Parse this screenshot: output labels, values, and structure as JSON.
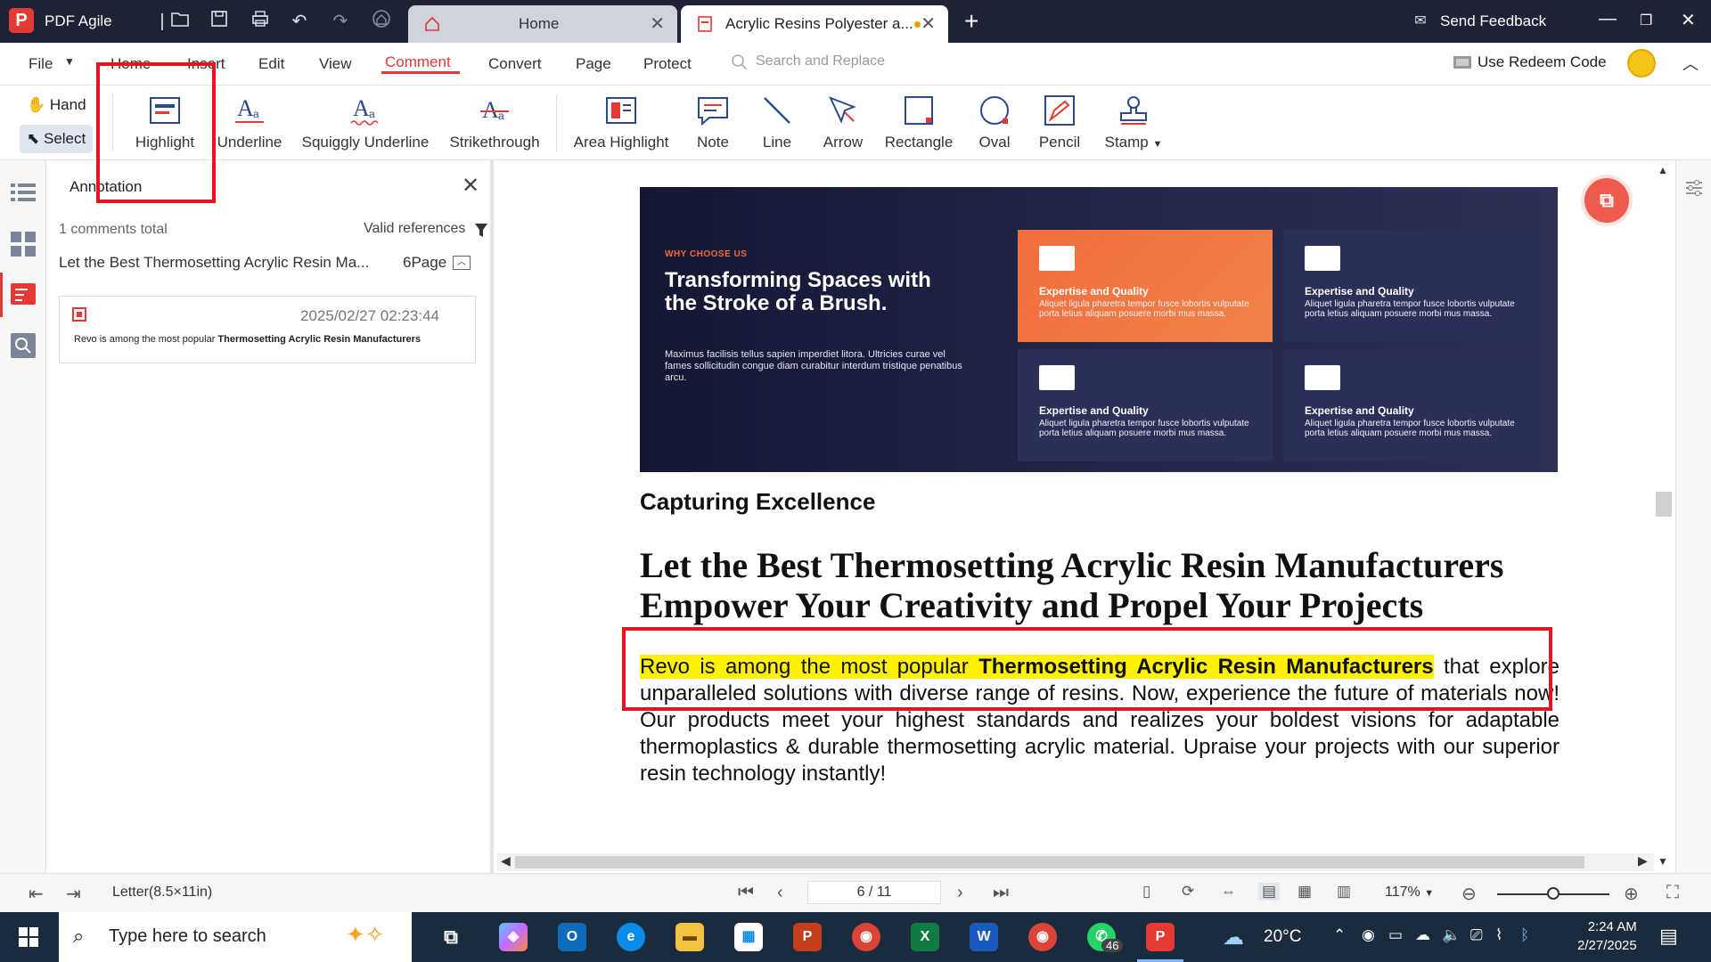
{
  "app": {
    "name": "PDF Agile"
  },
  "tabs": [
    {
      "label": "Home"
    },
    {
      "label": "Acrylic Resins  Polyester a..."
    }
  ],
  "window": {
    "send_feedback": "Send Feedback"
  },
  "menu": {
    "items": [
      "File",
      "Home",
      "Insert",
      "Edit",
      "View",
      "Comment",
      "Convert",
      "Page",
      "Protect"
    ],
    "active": "Comment",
    "search_placeholder": "Search and Replace",
    "redeem": "Use Redeem Code"
  },
  "toolbar": {
    "hand": "Hand",
    "select": "Select",
    "tools": [
      "Highlight",
      "Underline",
      "Squiggly Underline",
      "Strikethrough",
      "Area Highlight",
      "Note",
      "Line",
      "Arrow",
      "Rectangle",
      "Oval",
      "Pencil",
      "Stamp"
    ]
  },
  "annotation_panel": {
    "title": "Annotation",
    "total": "1 comments total",
    "valid_refs": "Valid references",
    "doc_title": "Let the Best Thermosetting Acrylic Resin Ma...",
    "page": "6Page",
    "comment": {
      "date": "2025/02/27 02:23:44",
      "snippet_pre": "Revo is among the most popular ",
      "snippet_bold": "Thermosetting Acrylic Resin Manufacturers"
    }
  },
  "document": {
    "banner": {
      "kicker": "WHY CHOOSE US",
      "title": "Transforming Spaces with the Stroke of a Brush.",
      "desc": "Maximus facilisis tellus sapien imperdiet litora. Ultricies curae vel fames sollicitudin congue diam curabitur interdum tristique penatibus arcu.",
      "card_title": "Expertise and Quality",
      "card_text": "Aliquet ligula pharetra tempor fusce lobortis vulputate porta letius aliquam posuere morbi mus massa."
    },
    "subheading": "Capturing Excellence",
    "heading": "Let the Best Thermosetting Acrylic Resin Manufacturers Empower Your Creativity and Propel Your Projects",
    "para_hl_a": "Revo is among the most popular ",
    "para_hl_b": "Thermosetting Acrylic Resin Manufacturers",
    "para_rest": " that explore unparalleled solutions with diverse range of resins. Now, experience the future of materials now! Our products meet your highest standards and realizes your boldest visions for adaptable thermoplastics & durable thermosetting acrylic material. Upraise your projects with our superior resin technology instantly!"
  },
  "status": {
    "page_size": "Letter(8.5×11in)",
    "page_indicator": "6 / 11",
    "zoom": "117%"
  },
  "taskbar": {
    "search_placeholder": "Type here to search",
    "temperature": "20°C",
    "time": "2:24 AM",
    "date": "2/27/2025",
    "whatsapp_badge": "46"
  },
  "colors": {
    "accent": "#e53935",
    "highlight": "#fff200",
    "titlebar": "#1e2235"
  }
}
